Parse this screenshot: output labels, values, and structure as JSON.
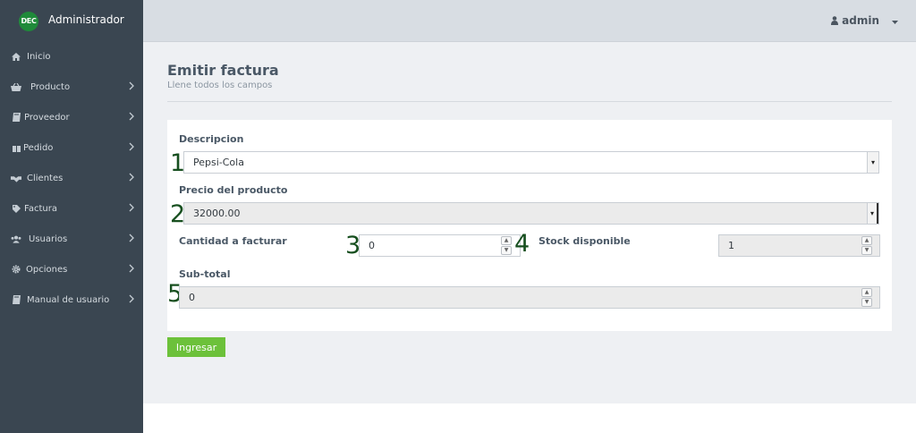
{
  "brand": {
    "logo_text": "DEC",
    "name": "Administrador"
  },
  "sidebar": {
    "items": [
      {
        "label": "Inicio",
        "icon": "home-icon",
        "has_chevron": false
      },
      {
        "label": "Producto",
        "icon": "basket-icon",
        "has_chevron": true
      },
      {
        "label": "Proveedor",
        "icon": "book-icon",
        "has_chevron": true
      },
      {
        "label": "Pedido",
        "icon": "gift-icon",
        "has_chevron": true
      },
      {
        "label": "Clientes",
        "icon": "handshake-icon",
        "has_chevron": true
      },
      {
        "label": "Factura",
        "icon": "tag-icon",
        "has_chevron": true
      },
      {
        "label": "Usuarios",
        "icon": "users-icon",
        "has_chevron": true
      },
      {
        "label": "Opciones",
        "icon": "cog-icon",
        "has_chevron": true
      },
      {
        "label": "Manual de usuario",
        "icon": "book-icon",
        "has_chevron": true
      }
    ]
  },
  "topbar": {
    "user": "admin"
  },
  "page": {
    "title": "Emitir factura",
    "subtitle": "Llene todos los campos"
  },
  "form": {
    "descripcion": {
      "label": "Descripcion",
      "value": "Pepsi-Cola",
      "marker": "1"
    },
    "precio": {
      "label": "Precio del producto",
      "value": "32000.00",
      "marker": "2"
    },
    "cantidad": {
      "label": "Cantidad a facturar",
      "value": "0",
      "marker": "3"
    },
    "stock": {
      "label": "Stock disponible",
      "value": "1",
      "marker": "4"
    },
    "subtotal": {
      "label": "Sub-total",
      "value": "0",
      "marker": "5"
    },
    "submit_label": "Ingresar"
  },
  "colors": {
    "sidebar_bg": "#3a4651",
    "accent_green": "#6cc13a",
    "marker_green": "#174f1f"
  }
}
